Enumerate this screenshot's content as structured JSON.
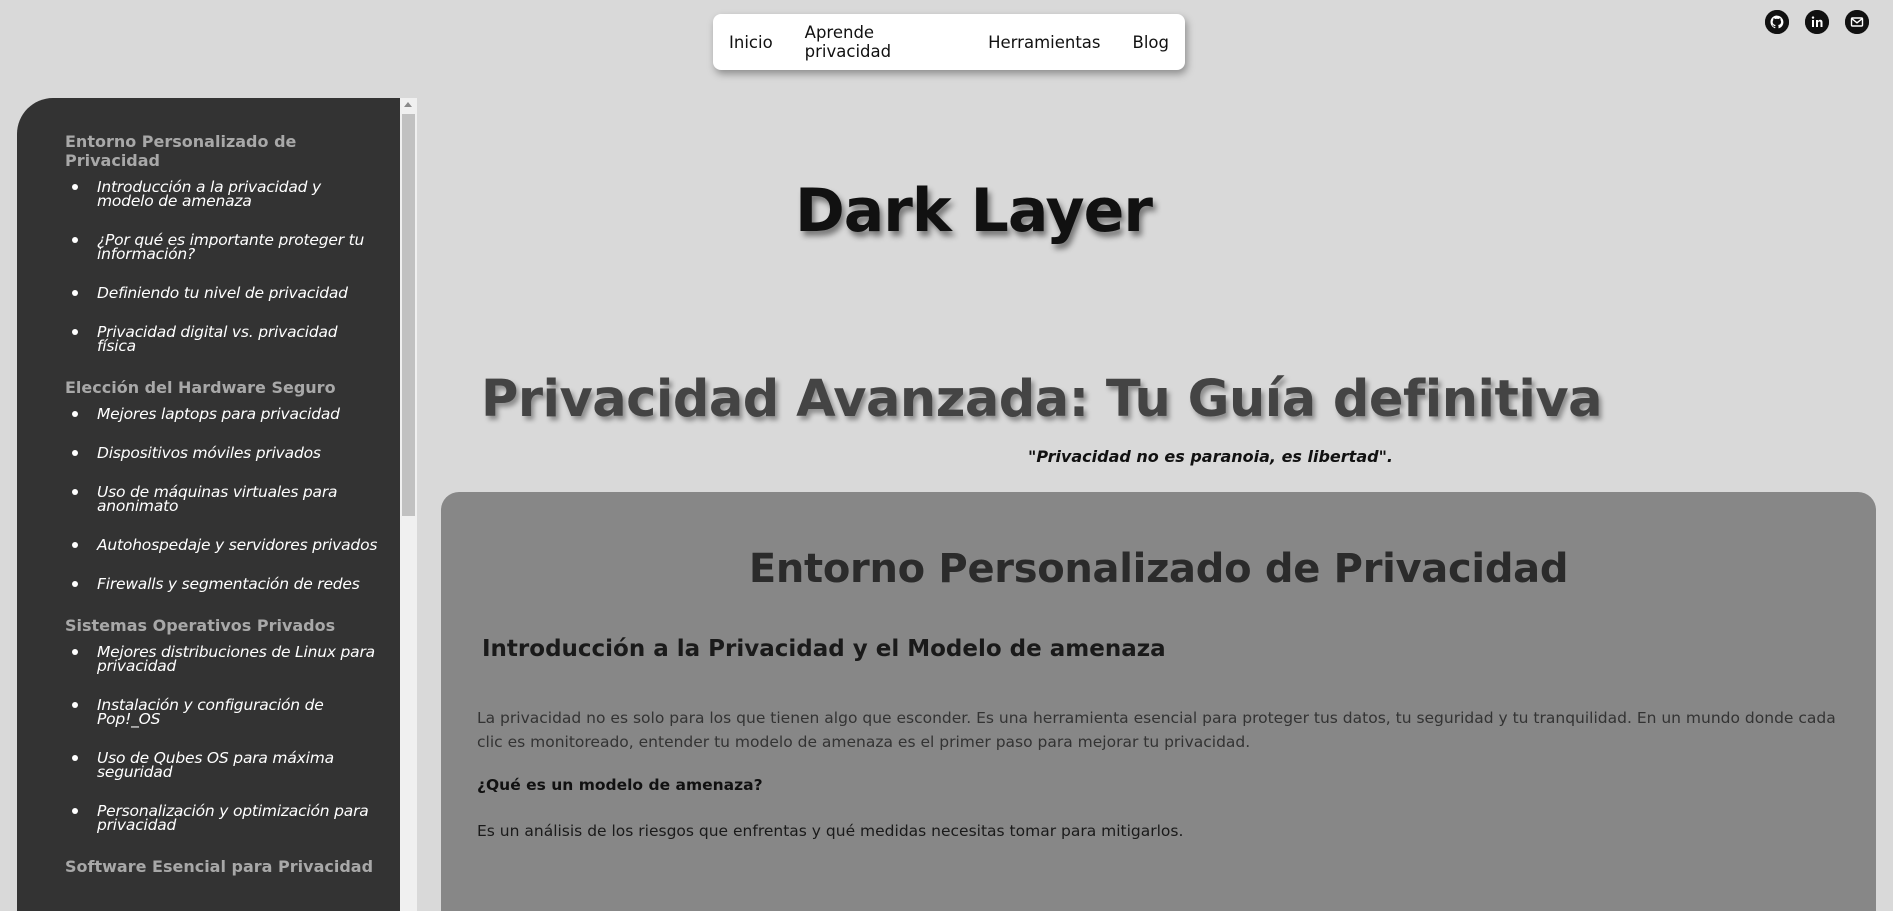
{
  "nav": {
    "items": [
      "Inicio",
      "Aprende privacidad",
      "Herramientas",
      "Blog"
    ]
  },
  "socials": [
    {
      "icon": "github-icon"
    },
    {
      "icon": "linkedin-icon"
    },
    {
      "icon": "mail-icon"
    }
  ],
  "sidebar": {
    "sections": [
      {
        "title": "Entorno Personalizado de Privacidad",
        "items": [
          "Introducción a la privacidad y modelo de amenaza",
          "¿Por qué es importante proteger tu información?",
          "Definiendo tu nivel de privacidad",
          "Privacidad digital vs. privacidad física"
        ]
      },
      {
        "title": "Elección del Hardware Seguro",
        "items": [
          "Mejores laptops para privacidad",
          "Dispositivos móviles privados",
          "Uso de máquinas virtuales para anonimato",
          "Autohospedaje y servidores privados",
          "Firewalls y segmentación de redes"
        ]
      },
      {
        "title": "Sistemas Operativos Privados",
        "items": [
          "Mejores distribuciones de Linux para privacidad",
          "Instalación y configuración de Pop!_OS",
          "Uso de Qubes OS para máxima seguridad",
          "Personalización y optimización para privacidad"
        ]
      },
      {
        "title": "Software Esencial para Privacidad",
        "items": []
      }
    ]
  },
  "brand": "Dark Layer",
  "hero": {
    "title": "Privacidad Avanzada: Tu Guía definitiva",
    "quote": "\"Privacidad no es paranoia, es libertad\"."
  },
  "content": {
    "section_title": "Entorno Personalizado de Privacidad",
    "subtitle": "Introducción a la Privacidad y el Modelo de amenaza",
    "paragraph": "La privacidad no es solo para los que tienen algo que esconder. Es una herramienta esencial para proteger tus datos, tu seguridad y tu tranquilidad. En un mundo donde cada clic es monitoreado, entender tu modelo de amenaza es el primer paso para mejorar tu privacidad.",
    "question": "¿Qué es un modelo de amenaza?",
    "answer": "Es un análisis de los riesgos que enfrentas y qué medidas necesitas tomar para mitigarlos."
  }
}
